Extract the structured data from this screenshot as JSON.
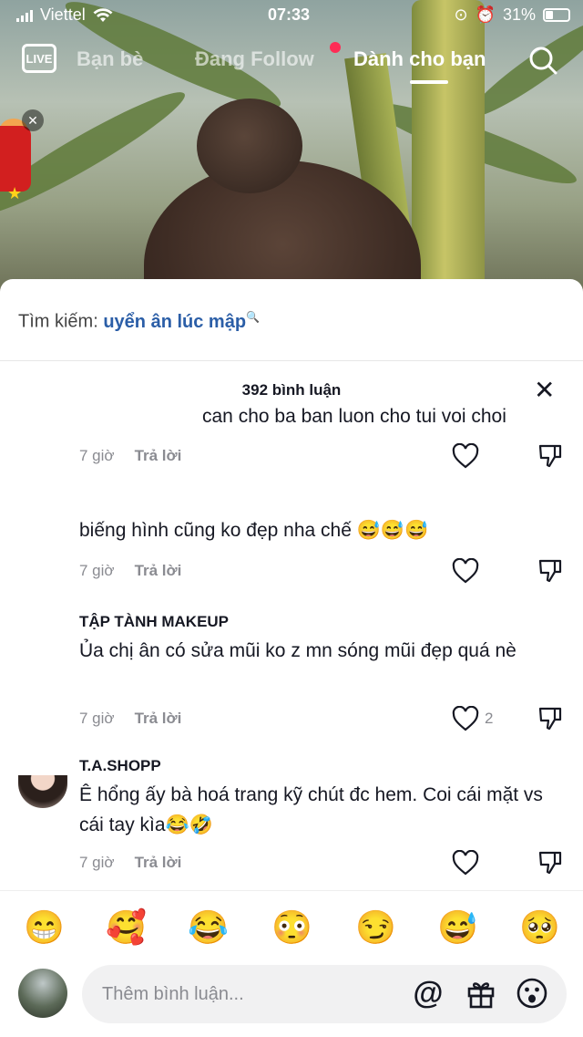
{
  "status_bar": {
    "carrier": "Viettel",
    "time": "07:33",
    "battery": "31%"
  },
  "nav": {
    "live_label": "LIVE",
    "tabs": [
      {
        "label": "Bạn bè"
      },
      {
        "label": "Đang Follow"
      },
      {
        "label": "Dành cho bạn"
      }
    ]
  },
  "search_suggestion": {
    "prefix": "Tìm kiếm:",
    "query": "uyển ân lúc mập"
  },
  "comments_header": {
    "count_label": "392 bình luận",
    "close_icon": "close-icon"
  },
  "comments": [
    {
      "username": "",
      "text": "can cho ba ban luon cho tui voi choi",
      "time": "7 giờ",
      "reply_label": "Trả lời",
      "likes": ""
    },
    {
      "username": "",
      "text": "biếng hình cũng ko đẹp nha chế 😅😅😅",
      "time": "7 giờ",
      "reply_label": "Trả lời",
      "likes": ""
    },
    {
      "username": "TẬP TÀNH MAKEUP",
      "text": "Ủa chị ân có sửa mũi ko z mn sóng mũi đẹp quá nè",
      "time": "7 giờ",
      "reply_label": "Trả lời",
      "likes": "2"
    },
    {
      "username": "T.A.SHOPP",
      "text": "Ê hổng ấy bà hoá trang kỹ chút đc hem. Coi cái mặt vs cái tay kìa😂🤣",
      "time": "7 giờ",
      "reply_label": "Trả lời",
      "likes": ""
    }
  ],
  "emoji_bar": [
    "😁",
    "🥰",
    "😂",
    "😳",
    "😏",
    "😅",
    "🥺"
  ],
  "input": {
    "placeholder": "Thêm bình luận...",
    "icons": [
      "at-icon",
      "gift-icon",
      "emoji-icon"
    ]
  },
  "colors": {
    "accent_blue": "#2b5ea7",
    "notification_red": "#fe2c55",
    "secondary_text": "#8a8b91"
  }
}
